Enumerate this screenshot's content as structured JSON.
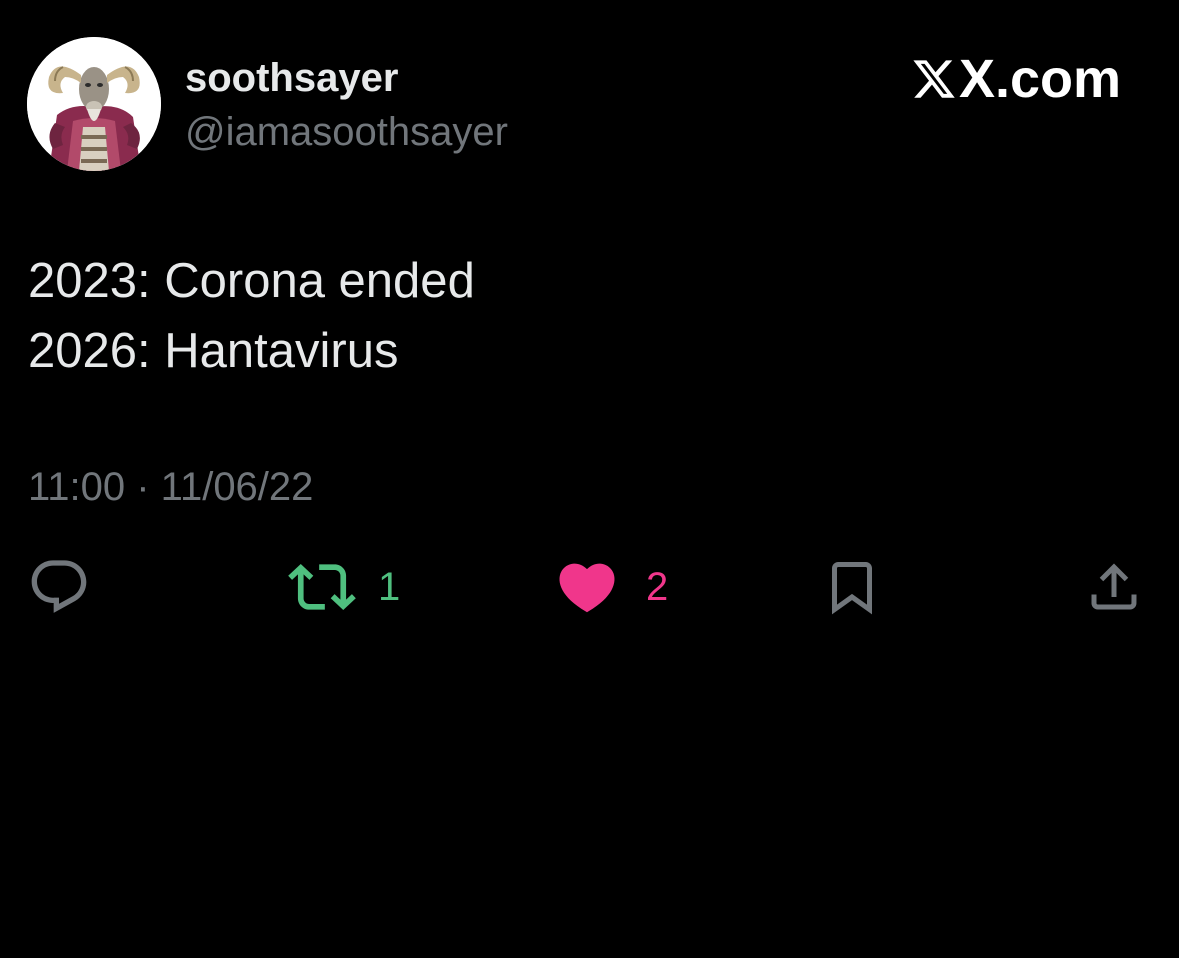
{
  "author": {
    "display_name": "soothsayer",
    "handle": "@iamasoothsayer",
    "avatar_icon": "goat-soothsayer-avatar"
  },
  "brand": {
    "logo_icon": "x-logo-icon",
    "label": "X.com"
  },
  "tweet": {
    "lines": [
      "2023: Corona ended",
      "2026: Hantavirus"
    ],
    "timestamp": "11:00 · 11/06/22"
  },
  "actions": {
    "reply": {
      "icon": "reply-icon",
      "count": ""
    },
    "retweet": {
      "icon": "retweet-icon",
      "count": "1",
      "color": "#4fbf7f"
    },
    "like": {
      "icon": "heart-icon",
      "count": "2",
      "color": "#f0368b"
    },
    "bookmark": {
      "icon": "bookmark-icon"
    },
    "share": {
      "icon": "share-icon"
    }
  },
  "colors": {
    "background": "#000000",
    "primary_text": "#e7e9ea",
    "secondary_text": "#71767b",
    "icon_gray": "#71767b",
    "retweet_green": "#4fbf7f",
    "like_pink": "#f0368b"
  }
}
